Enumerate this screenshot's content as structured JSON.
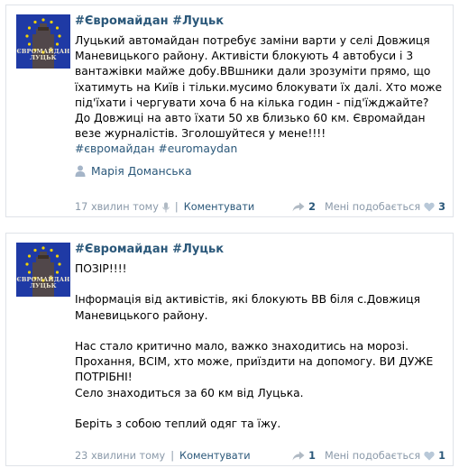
{
  "posts": [
    {
      "avatar_caption": "ЄВРОМАЙДАН ЛУЦЬК",
      "title": "#Євромайдан #Луцьк",
      "paragraphs": [
        "Луцький автомайдан потребує заміни варти у селі Довжиця Маневицького району. Активісти блокують 4 автобуси і 3 вантажівки майже добу.ВВшники дали зрозуміти прямо, що їхатимуть на Київ і тільки.мусимо блокувати їх далі. Хто може під'їхати і чергувати хоча б на кілька годин - під'їжджайте? До Довжиці на авто їхати 50 хв близько 60 км. Євромайдан везе журналістів. Зголошуйтеся у мене!!!!"
      ],
      "hashtags": "#євромайдан #euromaydan",
      "author": "Марія Доманська",
      "time": "17 хвилин тому",
      "comment_label": "Коментувати",
      "shares": "2",
      "like_label": "Мені подобається",
      "likes": "3"
    },
    {
      "avatar_caption": "ЄВРОМАЙДАН ЛУЦЬК",
      "title": "#Євромайдан #Луцьк",
      "paragraphs": [
        "ПОЗІР!!!!",
        "",
        "Інформація від активістів, які блокують ВВ біля с.Довжиця Маневицького району.",
        "",
        "Нас стало критично мало, важко знаходитись на морозі. Прохання, ВСІМ, хто може, приїздити на допомогу. ВИ ДУЖЕ ПОТРІБНІ!",
        "Село знаходиться за 60 км від Луцька.",
        "",
        "Беріть з собою теплий одяг та їжу."
      ],
      "time": "23 хвилини тому",
      "comment_label": "Коментувати",
      "shares": "1",
      "like_label": "Мені подобається",
      "likes": "1"
    }
  ],
  "colors": {
    "link": "#2b587a",
    "muted": "#8a99a9",
    "border": "#dfe3e8",
    "avatar_bg": "#1f3aa5",
    "stars": "#f2d200"
  },
  "icons": [
    "user-icon",
    "mic-icon",
    "share-icon",
    "heart-icon"
  ]
}
